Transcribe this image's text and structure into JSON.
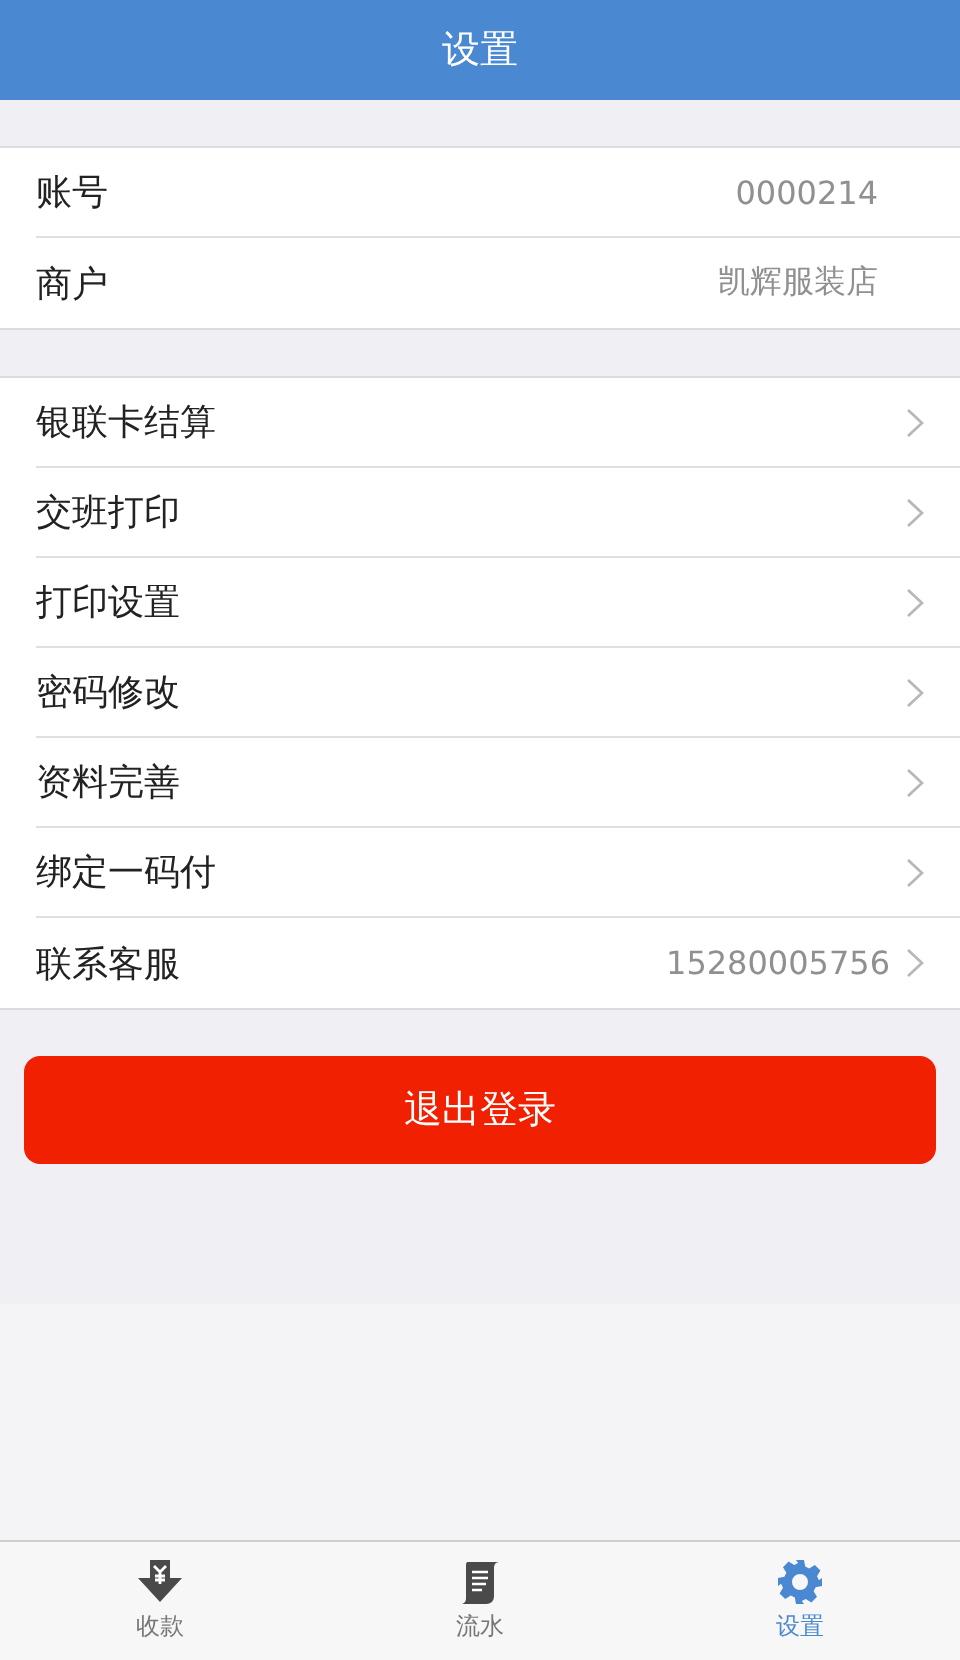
{
  "header": {
    "title": "设置"
  },
  "account": [
    {
      "label": "账号",
      "value": "0000214"
    },
    {
      "label": "商户",
      "value": "凯辉服装店"
    }
  ],
  "menu": [
    {
      "label": "银联卡结算"
    },
    {
      "label": "交班打印"
    },
    {
      "label": "打印设置"
    },
    {
      "label": "密码修改"
    },
    {
      "label": "资料完善"
    },
    {
      "label": "绑定一码付"
    },
    {
      "label": "联系客服",
      "value": "15280005756"
    }
  ],
  "logout": {
    "label": "退出登录"
  },
  "tabs": [
    {
      "label": "收款",
      "kind": "collect",
      "selected": false
    },
    {
      "label": "流水",
      "kind": "ledger",
      "selected": false
    },
    {
      "label": "设置",
      "kind": "settings",
      "selected": true
    }
  ]
}
